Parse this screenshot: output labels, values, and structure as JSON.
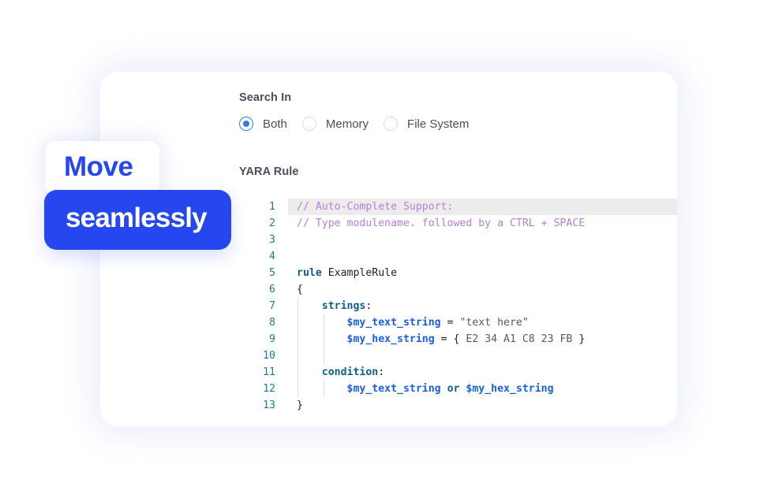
{
  "search_in": {
    "label": "Search In",
    "options": [
      {
        "label": "Both",
        "checked": true
      },
      {
        "label": "Memory",
        "checked": false
      },
      {
        "label": "File System",
        "checked": false
      }
    ]
  },
  "yara_rule": {
    "label": "YARA Rule",
    "lines": [
      {
        "n": "1",
        "tokens": [
          {
            "t": "// Auto-Complete Support:",
            "c": "comment"
          }
        ]
      },
      {
        "n": "2",
        "tokens": [
          {
            "t": "// Type modulename. followed by a CTRL + SPACE",
            "c": "comment"
          }
        ]
      },
      {
        "n": "3",
        "tokens": []
      },
      {
        "n": "4",
        "tokens": []
      },
      {
        "n": "5",
        "tokens": [
          {
            "t": "rule",
            "c": "kw"
          },
          {
            "t": " ExampleRule",
            "c": "plain"
          }
        ]
      },
      {
        "n": "6",
        "tokens": [
          {
            "t": "{",
            "c": "plain"
          }
        ]
      },
      {
        "n": "7",
        "tokens": [
          {
            "t": "    ",
            "c": "plain"
          },
          {
            "t": "strings",
            "c": "kw"
          },
          {
            "t": ":",
            "c": "plain"
          }
        ]
      },
      {
        "n": "8",
        "tokens": [
          {
            "t": "        ",
            "c": "plain"
          },
          {
            "t": "$my_text_string",
            "c": "var"
          },
          {
            "t": " = ",
            "c": "plain"
          },
          {
            "t": "\"text here\"",
            "c": "str"
          }
        ]
      },
      {
        "n": "9",
        "tokens": [
          {
            "t": "        ",
            "c": "plain"
          },
          {
            "t": "$my_hex_string",
            "c": "var"
          },
          {
            "t": " = { ",
            "c": "plain"
          },
          {
            "t": "E2 34 A1 C8 23 FB",
            "c": "str"
          },
          {
            "t": " }",
            "c": "plain"
          }
        ]
      },
      {
        "n": "10",
        "tokens": []
      },
      {
        "n": "11",
        "tokens": [
          {
            "t": "    ",
            "c": "plain"
          },
          {
            "t": "condition",
            "c": "kw"
          },
          {
            "t": ":",
            "c": "plain"
          }
        ]
      },
      {
        "n": "12",
        "tokens": [
          {
            "t": "        ",
            "c": "plain"
          },
          {
            "t": "$my_text_string",
            "c": "var"
          },
          {
            "t": " or ",
            "c": "kw"
          },
          {
            "t": "$my_hex_string",
            "c": "var"
          }
        ]
      },
      {
        "n": "13",
        "tokens": [
          {
            "t": "}",
            "c": "plain"
          }
        ]
      }
    ],
    "active_line": 1
  },
  "badges": {
    "top": "Move",
    "bottom": "seamlessly"
  },
  "colors": {
    "brand": "#2647f0",
    "radio_accent": "#2f7de1",
    "comment": "#b57fd6",
    "keyword": "#0f5f8c",
    "variable": "#1a5fe0",
    "line_number": "#1e7a93"
  }
}
